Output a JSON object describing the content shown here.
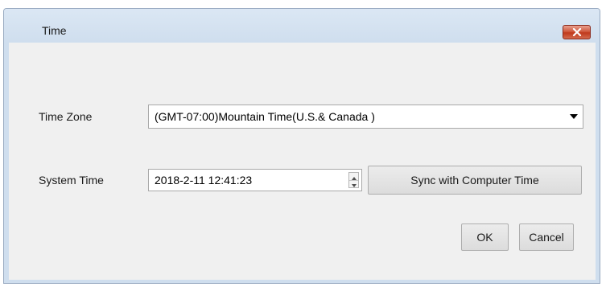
{
  "window": {
    "title": "Time",
    "close_icon": "close-x-icon",
    "close_color": "#c0391c"
  },
  "form": {
    "time_zone_label": "Time Zone",
    "time_zone_value": "(GMT-07:00)Mountain Time(U.S.& Canada )",
    "system_time_label": "System Time",
    "system_time_value": "2018-2-11 12:41:23",
    "sync_button": "Sync with Computer Time"
  },
  "footer": {
    "ok_label": "OK",
    "cancel_label": "Cancel"
  }
}
